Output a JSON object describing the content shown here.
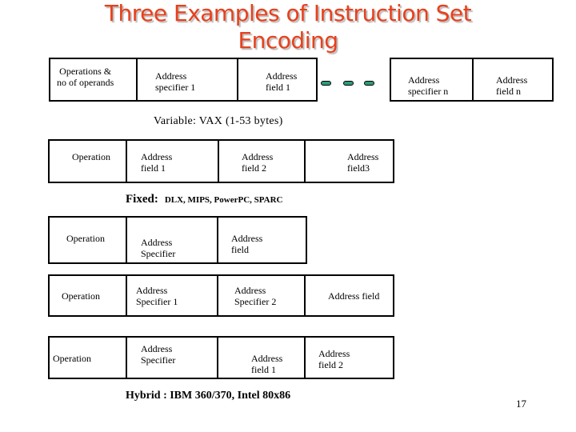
{
  "title": {
    "line1": "Three Examples of Instruction Set",
    "line2": "Encoding"
  },
  "variable_format": {
    "cells": [
      "Operations &\nno of operands",
      "Address\nspecifier 1",
      "Address\nfield 1",
      "Address\nspecifier n",
      "Address\nfield n"
    ],
    "ellipsis_icon": "green-dots-ellipsis",
    "caption": "Variable:  VAX  (1-53 bytes)"
  },
  "fixed_format": {
    "cells": [
      "Operation",
      "Address\nfield 1",
      "Address\nfield 2",
      "Address\nfield3"
    ],
    "caption_main": "Fixed:",
    "caption_examples": "DLX, MIPS, PowerPC, SPARC"
  },
  "hybrid_format": {
    "rows": [
      {
        "cells": [
          "Operation",
          "Address\nSpecifier",
          "Address\nfield"
        ]
      },
      {
        "cells": [
          "Operation",
          "Address\nSpecifier 1",
          "Address\nSpecifier 2",
          "Address field"
        ]
      },
      {
        "cells": [
          "Operation",
          "Address\nSpecifier",
          "Address\nfield 1",
          "Address\nfield 2"
        ]
      }
    ],
    "caption": "Hybrid : IBM 360/370,  Intel 80x86"
  },
  "page_number": "17",
  "colors": {
    "title": "#e8401c",
    "ellipsis_dot": "#2e9a7a"
  }
}
